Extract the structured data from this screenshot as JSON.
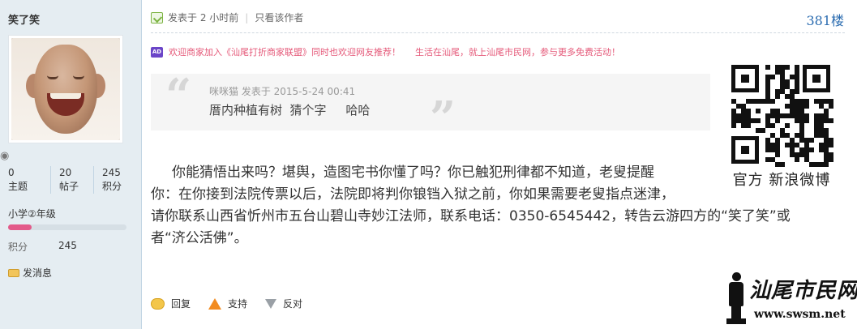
{
  "user": {
    "name": "笑了笑",
    "weibo_icon": "weibo-icon",
    "stats": [
      {
        "value": "0",
        "label": "主题"
      },
      {
        "value": "20",
        "label": "帖子"
      },
      {
        "value": "245",
        "label": "积分"
      }
    ],
    "rank": "小学②年级",
    "rank_progress": 0.2,
    "rank_color": "#e35a8a",
    "points_label": "积分",
    "points_value": "245",
    "send_message": "发消息"
  },
  "post": {
    "posted": "发表于 2 小时前",
    "only_author": "只看该作者",
    "floor": "381楼",
    "ad_badge": "AD",
    "ad_text_1": "欢迎商家加入《汕尾打折商家联盟》同时也欢迎网友推荐！",
    "ad_text_2": "生活在汕尾，就上汕尾市民网，参与更多免费活动！",
    "ad_color": "#e55a7a",
    "quote": {
      "meta": "咪咪猫 发表于 2015-5-24 00:41",
      "text": "厝内种植有树  猜个字     哈哈"
    },
    "qr_caption": "官方 新浪微博",
    "content": [
      "你能猜悟出来吗？堪舆，造图宅书你懂了吗？你已触犯刑律都不知道，老叟提醒",
      "你：在你接到法院传票以后，法院即将判你锒铛入狱之前，你如果需要老叟指点迷津，",
      "请你联系山西省忻州市五台山碧山寺妙江法师，联系电话：0350-6545442，转告云游四方的“笑了笑”或",
      "者“济公活佛”。"
    ],
    "actions": {
      "reply": "回复",
      "support": "支持",
      "oppose": "反对"
    }
  },
  "watermark": {
    "title": "汕尾市民网",
    "url": "www.swsm.net"
  },
  "colors": {
    "sidebar_bg": "#e5edf2",
    "floor_link": "#2b6cb0"
  }
}
